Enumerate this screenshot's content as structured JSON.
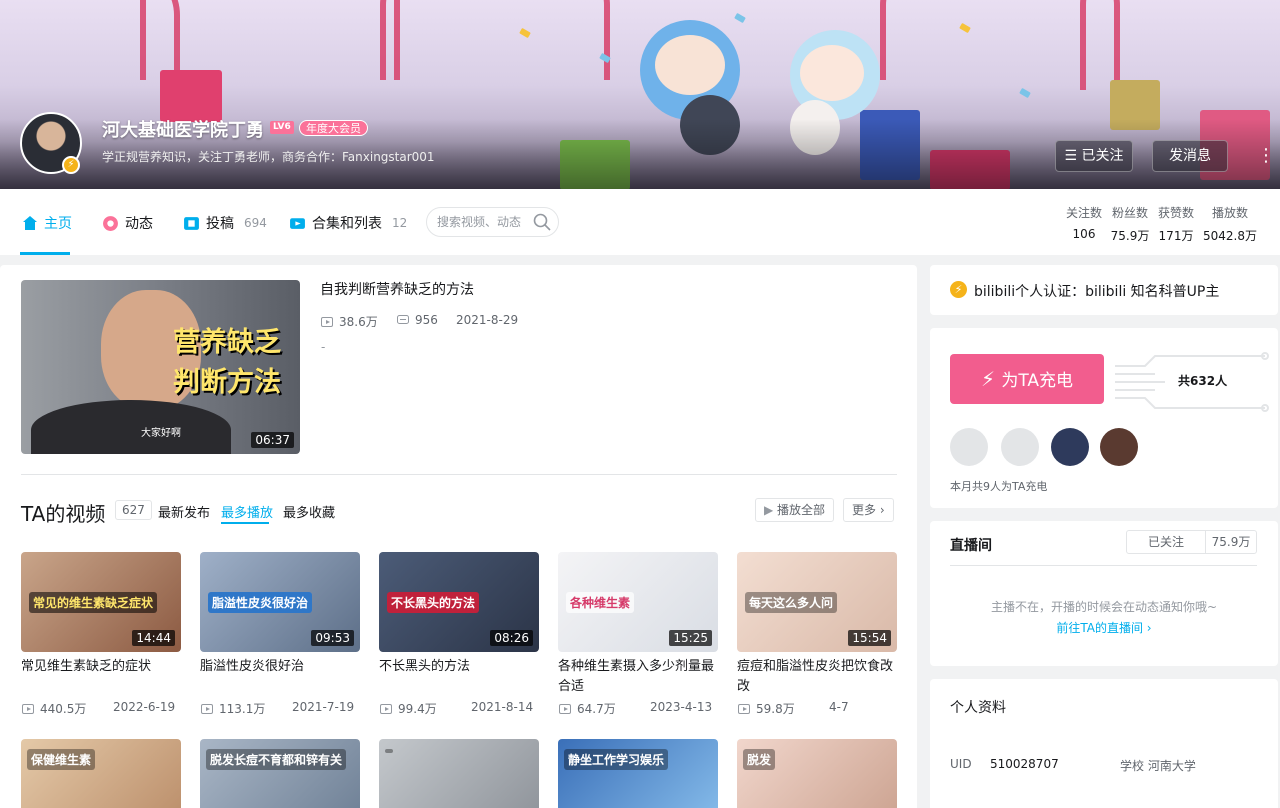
{
  "header": {
    "username": "河大基础医学院丁勇",
    "level": "LV6",
    "vip": "年度大会员",
    "sign": "学正规营养知识，关注丁勇老师，商务合作：Fanxingstar001",
    "follow_label": "已关注",
    "message_label": "发消息",
    "more": "⋮"
  },
  "nav": {
    "home": "主页",
    "dynamic": "动态",
    "upload": "投稿",
    "upload_count": "694",
    "collection": "合集和列表",
    "collection_count": "12",
    "search_placeholder": "搜索视频、动态"
  },
  "stats": [
    {
      "label": "关注数",
      "value": "106"
    },
    {
      "label": "粉丝数",
      "value": "75.9万"
    },
    {
      "label": "获赞数",
      "value": "171万"
    },
    {
      "label": "播放数",
      "value": "5042.8万"
    }
  ],
  "pinned": {
    "title": "自我判断营养缺乏的方法",
    "views": "38.6万",
    "comments": "956",
    "date": "2021-8-29",
    "desc": "-",
    "duration": "06:37",
    "thumb_text1": "营养缺乏",
    "thumb_text2": "判断方法",
    "thumb_caption": "大家好啊"
  },
  "videos_section": {
    "title": "TA的视频",
    "count": "627",
    "tab_latest": "最新发布",
    "tab_most_played": "最多播放",
    "tab_most_fav": "最多收藏",
    "play_all": "播放全部",
    "more": "更多"
  },
  "videos": [
    {
      "title": "常见维生素缺乏的症状",
      "views": "440.5万",
      "date": "2022-6-19",
      "duration": "14:44",
      "thumb_text": "常见的维生素缺乏症状"
    },
    {
      "title": "脂溢性皮炎很好治",
      "views": "113.1万",
      "date": "2021-7-19",
      "duration": "09:53",
      "thumb_text": "脂溢性皮炎很好治"
    },
    {
      "title": "不长黑头的方法",
      "views": "99.4万",
      "date": "2021-8-14",
      "duration": "08:26",
      "thumb_text": "不长黑头的方法"
    },
    {
      "title": "各种维生素摄入多少剂量最合适",
      "views": "64.7万",
      "date": "2023-4-13",
      "duration": "15:25",
      "thumb_text": "各种维生素"
    },
    {
      "title": "痘痘和脂溢性皮炎把饮食改改",
      "views": "59.8万",
      "date": "4-7",
      "duration": "15:54",
      "thumb_text": "每天这么多人问"
    }
  ],
  "row2_thumbs": [
    "保健维生素",
    "脱发长痘不育都和锌有关",
    "",
    "静坐工作学习娱乐",
    "脱发"
  ],
  "side": {
    "cert": "bilibili个人认证：bilibili 知名科普UP主",
    "charge_button": "为TA充电",
    "charge_total_prefix": "共",
    "charge_total": "632",
    "charge_total_suffix": "人",
    "charge_month": "本月共9人为TA充电",
    "live_title": "直播间",
    "live_follow": "已关注",
    "live_fans": "75.9万",
    "live_off": "主播不在，开播的时候会在动态通知你哦~",
    "live_link": "前往TA的直播间",
    "profile_title": "个人资料",
    "uid_label": "UID",
    "uid": "510028707",
    "school": "学校 河南大学"
  },
  "colors": {
    "accent": "#00aeec",
    "pink": "#fb7299",
    "gold": "#f5b31a"
  }
}
